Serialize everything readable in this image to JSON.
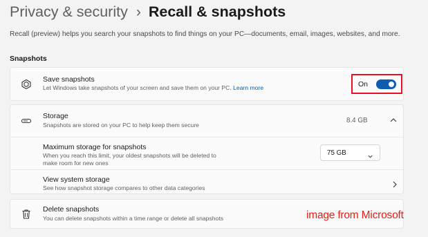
{
  "breadcrumb": {
    "parent": "Privacy & security",
    "separator": "›",
    "current": "Recall & snapshots"
  },
  "description": "Recall (preview) helps you search your snapshots to find things on your PC—documents, email, images, websites, and more.",
  "section": {
    "title": "Snapshots"
  },
  "save_snapshots": {
    "icon": "recall-icon",
    "title": "Save snapshots",
    "subtitle": "Let Windows take snapshots of your screen and save them on your PC.",
    "link": "Learn more",
    "toggle_label": "On",
    "toggle_on": true
  },
  "storage": {
    "icon": "storage-icon",
    "title": "Storage",
    "subtitle": "Snapshots are stored on your PC to help keep them secure",
    "value": "8.4 GB",
    "expanded": true,
    "max_storage": {
      "title": "Maximum storage for snapshots",
      "subtitle_line1": "When you reach this limit, your oldest snapshots will be deleted to",
      "subtitle_line2": "make room for new ones",
      "selected": "75 GB"
    },
    "view_system_storage": {
      "title": "View system storage",
      "subtitle": "See how snapshot storage compares to other data categories"
    }
  },
  "delete_snapshots": {
    "icon": "trash-icon",
    "title": "Delete snapshots",
    "subtitle": "You can delete snapshots within a time range or delete all snapshots"
  },
  "watermark": "image from Microsoft",
  "colors": {
    "accent": "#0f5cb0",
    "highlight_border": "#e81123",
    "watermark": "#e81d16",
    "link": "#005fb8"
  }
}
